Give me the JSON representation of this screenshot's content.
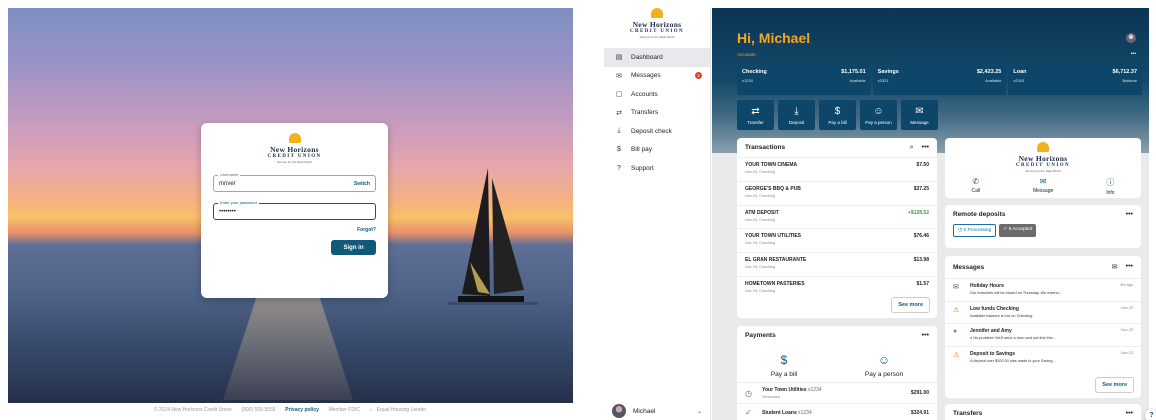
{
  "login": {
    "brand_line1": "New Horizons",
    "brand_line2": "CREDIT UNION",
    "brand_tagline": "Service for the Real World",
    "username_label": "Username",
    "username_value": "mriver",
    "switch_label": "Switch",
    "password_label": "Enter your password",
    "password_value": "••••••••",
    "forgot_label": "Forgot?",
    "signin_label": "Sign in"
  },
  "footer": {
    "copyright": "© 2024 New Horizons Credit Union",
    "phone": "(800) 555-5555",
    "privacy": "Privacy policy",
    "fdic": "Member FDIC",
    "housing": "Equal Housing Lender",
    "sep": "·"
  },
  "sidebar": {
    "items": [
      {
        "label": "Dashboard",
        "icon": "▤"
      },
      {
        "label": "Messages",
        "icon": "✉",
        "badge": "2"
      },
      {
        "label": "Accounts",
        "icon": "▢"
      },
      {
        "label": "Transfers",
        "icon": "⇄"
      },
      {
        "label": "Deposit check",
        "icon": "⤓"
      },
      {
        "label": "Bill pay",
        "icon": "$"
      },
      {
        "label": "Support",
        "icon": "?"
      }
    ],
    "user_name": "Michael"
  },
  "dashboard": {
    "greeting": "Hi, Michael",
    "accounts_label": "Accounts",
    "more": "•••",
    "accounts": [
      {
        "name": "Checking",
        "amount": "$1,175.01",
        "num": "x1234",
        "status": "Available"
      },
      {
        "name": "Savings",
        "amount": "$2,423.25",
        "num": "x3321",
        "status": "Available"
      },
      {
        "name": "Loan",
        "amount": "$6,712.37",
        "num": "x2343",
        "status": "Balance"
      }
    ],
    "actions": [
      {
        "label": "Transfer",
        "icon": "⇄"
      },
      {
        "label": "Deposit",
        "icon": "⤓"
      },
      {
        "label": "Pay a bill",
        "icon": "$"
      },
      {
        "label": "Pay a person",
        "icon": "☺"
      },
      {
        "label": "Message",
        "icon": "✉"
      }
    ]
  },
  "transactions": {
    "title": "Transactions",
    "see_more": "See more",
    "items": [
      {
        "name": "YOUR TOWN CINEMA",
        "date": "Nov 25, Checking",
        "amount": "$7.50",
        "pos": false
      },
      {
        "name": "GEORGE'S BBQ & PUB",
        "date": "Nov 25, Checking",
        "amount": "$37.25",
        "pos": false
      },
      {
        "name": "ATM DEPOSIT",
        "date": "Nov 25, Checking",
        "amount": "+$128.52",
        "pos": true
      },
      {
        "name": "YOUR TOWN UTILITIES",
        "date": "Nov 25, Checking",
        "amount": "$76.46",
        "pos": false
      },
      {
        "name": "EL GRAN RESTAURANTE",
        "date": "Nov 25, Checking",
        "amount": "$13.98",
        "pos": false
      },
      {
        "name": "HOMETOWN PASTERIES",
        "date": "Nov 25, Checking",
        "amount": "$1.57",
        "pos": false
      }
    ]
  },
  "payments": {
    "title": "Payments",
    "pay_bill": "Pay a bill",
    "pay_person": "Pay a person",
    "items": [
      {
        "name": "Your Town Utilities",
        "acct": "x1234",
        "status": "Scheduled",
        "amount": "$291.00"
      },
      {
        "name": "Student Loans",
        "acct": "x1234",
        "status": "",
        "amount": "$324.91"
      }
    ]
  },
  "contact": {
    "brand_line1": "New Horizons",
    "brand_line2": "CREDIT UNION",
    "brand_tagline": "Service for the Real World",
    "call": "Call",
    "message": "Message",
    "info": "Info"
  },
  "remote": {
    "title": "Remote deposits",
    "processing": "0 Processing",
    "accepted": "9 Accepted"
  },
  "messages": {
    "title": "Messages",
    "see_more": "See more",
    "items": [
      {
        "title": "Holiday Hours",
        "sub": "Our branches will be closed on Thursday. We extend...",
        "date": "8m ago",
        "icon": "✉",
        "kind": "msg"
      },
      {
        "title": "Low funds Checking",
        "sub": "Available balance is low on Checking",
        "date": "Nov 25",
        "icon": "⚠",
        "kind": "warn"
      },
      {
        "title": "Jennifer and Amy",
        "sub": "No problem! We'll send a new card out first thin...",
        "date": "Nov 25",
        "icon": "●",
        "kind": "person"
      },
      {
        "title": "Deposit to Savings",
        "sub": "A deposit over $200.00 was made to your Saving...",
        "date": "Nov 22",
        "icon": "⚠",
        "kind": "warn"
      }
    ]
  },
  "transfers": {
    "title": "Transfers"
  },
  "help": {
    "label": "?"
  }
}
